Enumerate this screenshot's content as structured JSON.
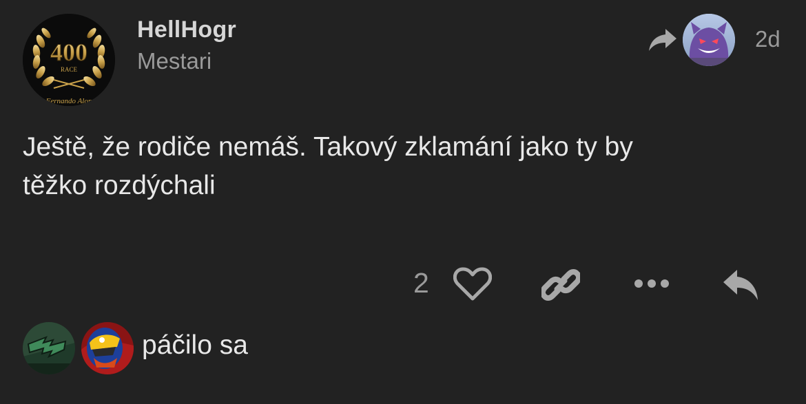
{
  "post": {
    "author": {
      "username": "HellHogr",
      "title": "Mestari",
      "avatar_icon": "laurel-400-race-badge-icon",
      "avatar_text": "400",
      "avatar_subtext": "RACE",
      "avatar_caption": "Fernando Alon"
    },
    "reply_to": {
      "arrow_icon": "reply-arrow-icon",
      "avatar_icon": "gengar-avatar-icon"
    },
    "date": "2d",
    "body": "Ještě, že rodiče nemáš. Takový zklamání jako ty by\ntěžko rozdýchali",
    "actions": {
      "like_count": "2",
      "like_icon": "heart-icon",
      "link_icon": "link-icon",
      "more_icon": "ellipsis-icon",
      "reply_icon": "reply-icon"
    },
    "likes": {
      "label": "páčilo sa",
      "avatars": [
        "green-logo-avatar",
        "racing-helmet-avatar"
      ]
    }
  },
  "colors": {
    "background": "#222222",
    "text_primary": "#e8e8e8",
    "text_muted": "#9a9a9a",
    "icon": "#a8a8a8",
    "gold": "#c9a14a"
  }
}
